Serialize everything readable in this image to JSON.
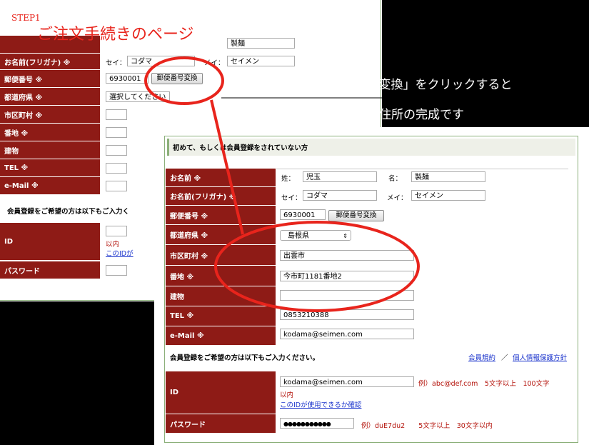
{
  "step": {
    "label": "STEP1",
    "title": "ご注文手続きのページ"
  },
  "callout": {
    "line1": "郵便番号を入れて「郵便番号変換」をクリックすると",
    "line2": "番地や建物名だけで入れれば住所の完成です"
  },
  "back_form": {
    "top_value": "製麺",
    "rows": {
      "kana_label": "お名前(フリガナ) ※",
      "sei_kana_label": "セイ：",
      "sei_kana_value": "コダマ",
      "mei_kana_label": "メイ：",
      "mei_kana_value": "セイメン",
      "zip_label": "郵便番号 ※",
      "zip_value": "6930001",
      "zip_button": "郵便番号変換",
      "pref_label": "都道府県 ※",
      "pref_value": "選択してください",
      "city_label": "市区町村 ※",
      "street_label": "番地 ※",
      "building_label": "建物",
      "tel_label": "TEL ※",
      "email_label": "e-Mail ※"
    },
    "member_note": "会員登録をご希望の方は以下もご入力く",
    "id_label": "ID",
    "id_suffix": "以内",
    "id_link": "このIDが",
    "password_label": "パスワード"
  },
  "front_form": {
    "section_title": "初めて、もしくは会員登録をされていない方",
    "name": {
      "label": "お名前 ※",
      "sei_label": "姓：",
      "sei_value": "児玉",
      "mei_label": "名：",
      "mei_value": "製麺"
    },
    "kana": {
      "label": "お名前(フリガナ) ※",
      "sei_label": "セイ：",
      "sei_value": "コダマ",
      "mei_label": "メイ：",
      "mei_value": "セイメン"
    },
    "zip": {
      "label": "郵便番号 ※",
      "value": "6930001",
      "button": "郵便番号変換"
    },
    "pref": {
      "label": "都道府県 ※",
      "value": "島根県"
    },
    "city": {
      "label": "市区町村 ※",
      "value": "出雲市"
    },
    "street": {
      "label": "番地 ※",
      "value": "今市町1181番地2"
    },
    "building": {
      "label": "建物",
      "value": ""
    },
    "tel": {
      "label": "TEL ※",
      "value": "0853210388"
    },
    "email": {
      "label": "e-Mail ※",
      "value": "kodama@seimen.com"
    },
    "member_note": "会員登録をご希望の方は以下もご入力ください。",
    "links": {
      "terms": "会員規約",
      "separator": "／",
      "privacy": "個人情報保護方針"
    },
    "id": {
      "label": "ID",
      "value": "kodama@seimen.com",
      "hint": "例）abc@def.com　5文字以上　100文字",
      "hint2": "以内",
      "check_link": "このIDが使用できるか確認"
    },
    "password": {
      "label": "パスワード",
      "value": "●●●●●●●●●●●",
      "hint": "例）duE7du2　　5文字以上　30文字以内"
    }
  },
  "colors": {
    "label_bg": "#8e1b16",
    "highlight": "#e8241c",
    "panel_border": "#8cb07a"
  }
}
